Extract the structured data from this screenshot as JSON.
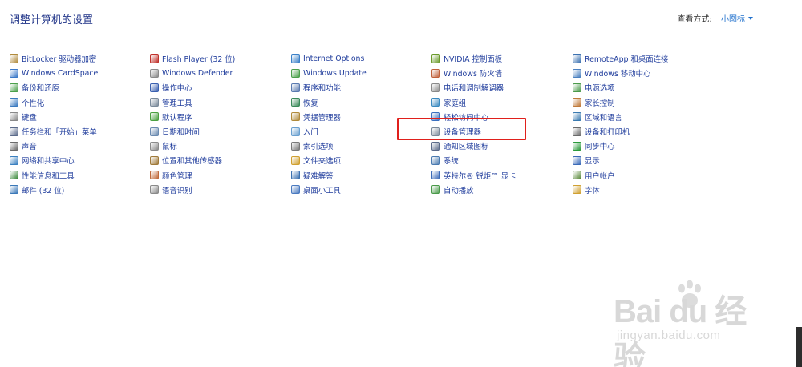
{
  "page": {
    "title": "调整计算机的设置",
    "view_by_label": "查看方式:",
    "view_by_value": "小图标"
  },
  "columns": [
    {
      "items": [
        {
          "label": "BitLocker 驱动器加密",
          "icon": "bitlocker-icon",
          "color": "#b08a3a"
        },
        {
          "label": "Windows CardSpace",
          "icon": "cardspace-icon",
          "color": "#3a78c8"
        },
        {
          "label": "备份和还原",
          "icon": "backup-icon",
          "color": "#4aa04a"
        },
        {
          "label": "个性化",
          "icon": "personalization-icon",
          "color": "#3a7ac0"
        },
        {
          "label": "键盘",
          "icon": "keyboard-icon",
          "color": "#888888"
        },
        {
          "label": "任务栏和「开始」菜单",
          "icon": "taskbar-icon",
          "color": "#5a6a8a"
        },
        {
          "label": "声音",
          "icon": "sound-icon",
          "color": "#6a6a6a"
        },
        {
          "label": "网络和共享中心",
          "icon": "network-icon",
          "color": "#3a80c0"
        },
        {
          "label": "性能信息和工具",
          "icon": "performance-icon",
          "color": "#3a8a3a"
        },
        {
          "label": "邮件 (32 位)",
          "icon": "mail-icon",
          "color": "#3a78b8"
        }
      ]
    },
    {
      "items": [
        {
          "label": "Flash Player (32 位)",
          "icon": "flash-icon",
          "color": "#c0302a"
        },
        {
          "label": "Windows Defender",
          "icon": "defender-icon",
          "color": "#8a8a8a"
        },
        {
          "label": "操作中心",
          "icon": "flag-icon",
          "color": "#3a60b0"
        },
        {
          "label": "管理工具",
          "icon": "admin-tools-icon",
          "color": "#7a8a9a"
        },
        {
          "label": "默认程序",
          "icon": "default-programs-icon",
          "color": "#4aa040"
        },
        {
          "label": "日期和时间",
          "icon": "clock-icon",
          "color": "#6a8ab0"
        },
        {
          "label": "鼠标",
          "icon": "mouse-icon",
          "color": "#8a8a8a"
        },
        {
          "label": "位置和其他传感器",
          "icon": "sensor-icon",
          "color": "#a07a3a"
        },
        {
          "label": "颜色管理",
          "icon": "color-mgmt-icon",
          "color": "#c06a3a"
        },
        {
          "label": "语音识别",
          "icon": "microphone-icon",
          "color": "#8a8a8a"
        }
      ]
    },
    {
      "items": [
        {
          "label": "Internet Options",
          "icon": "internet-options-icon",
          "color": "#3a80c8"
        },
        {
          "label": "Windows Update",
          "icon": "windows-update-icon",
          "color": "#4aa04a"
        },
        {
          "label": "程序和功能",
          "icon": "programs-icon",
          "color": "#5a7ab0"
        },
        {
          "label": "恢复",
          "icon": "recovery-icon",
          "color": "#3a8a5a"
        },
        {
          "label": "凭据管理器",
          "icon": "credential-icon",
          "color": "#b08a3a"
        },
        {
          "label": "入门",
          "icon": "getting-started-icon",
          "color": "#6aa0d0"
        },
        {
          "label": "索引选项",
          "icon": "index-icon",
          "color": "#7a7a7a"
        },
        {
          "label": "文件夹选项",
          "icon": "folder-icon",
          "color": "#d0a030"
        },
        {
          "label": "疑难解答",
          "icon": "troubleshoot-icon",
          "color": "#3a70b0"
        },
        {
          "label": "桌面小工具",
          "icon": "gadgets-icon",
          "color": "#4a7ac0"
        }
      ]
    },
    {
      "items": [
        {
          "label": "NVIDIA 控制面板",
          "icon": "nvidia-icon",
          "color": "#6a9a2a"
        },
        {
          "label": "Windows 防火墙",
          "icon": "firewall-icon",
          "color": "#c0603a"
        },
        {
          "label": "电话和调制解调器",
          "icon": "phone-icon",
          "color": "#8a8a8a"
        },
        {
          "label": "家庭组",
          "icon": "homegroup-icon",
          "color": "#3a8ac0"
        },
        {
          "label": "轻松访问中心",
          "icon": "ease-of-access-icon",
          "color": "#3a70c0"
        },
        {
          "label": "设备管理器",
          "icon": "device-manager-icon",
          "color": "#7a8a9a"
        },
        {
          "label": "通知区域图标",
          "icon": "notification-icon",
          "color": "#5a6a8a"
        },
        {
          "label": "系统",
          "icon": "system-icon",
          "color": "#4a7ab0"
        },
        {
          "label": "英特尔® 锐炬™ 显卡",
          "icon": "intel-graphics-icon",
          "color": "#3a6ab8"
        },
        {
          "label": "自动播放",
          "icon": "autoplay-icon",
          "color": "#4a9a4a"
        }
      ]
    },
    {
      "items": [
        {
          "label": "RemoteApp 和桌面连接",
          "icon": "remoteapp-icon",
          "color": "#3a70b0"
        },
        {
          "label": "Windows 移动中心",
          "icon": "mobility-icon",
          "color": "#4a80c0"
        },
        {
          "label": "电源选项",
          "icon": "power-icon",
          "color": "#4a9a4a"
        },
        {
          "label": "家长控制",
          "icon": "parental-icon",
          "color": "#c07a3a"
        },
        {
          "label": "区域和语言",
          "icon": "region-icon",
          "color": "#3a7ab0"
        },
        {
          "label": "设备和打印机",
          "icon": "printer-icon",
          "color": "#6a6a6a"
        },
        {
          "label": "同步中心",
          "icon": "sync-icon",
          "color": "#2a9a3a"
        },
        {
          "label": "显示",
          "icon": "display-icon",
          "color": "#3a6ab8"
        },
        {
          "label": "用户帐户",
          "icon": "user-icon",
          "color": "#5a8a3a"
        },
        {
          "label": "字体",
          "icon": "font-icon",
          "color": "#d0a030"
        }
      ]
    }
  ],
  "highlight": {
    "target": "设备管理器",
    "color": "#e0201c"
  },
  "watermark": {
    "main": "Bai du 经验",
    "sub": "jingyan.baidu.com"
  }
}
